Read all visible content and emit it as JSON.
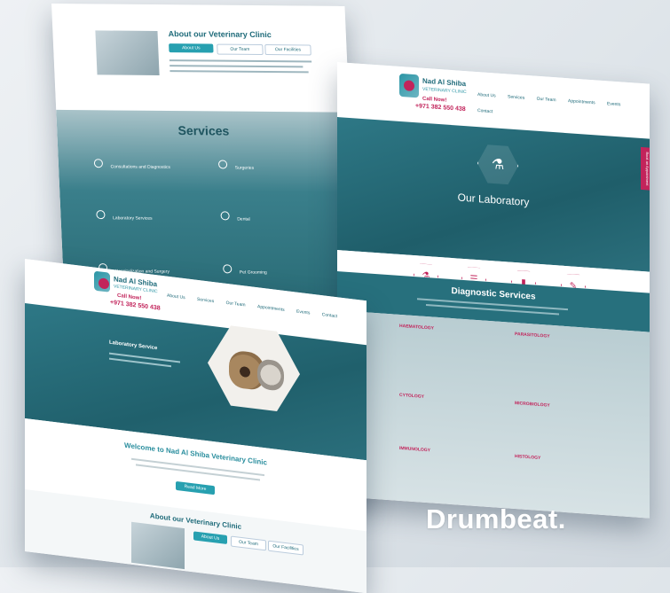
{
  "page_left": {
    "about_heading": "About our Veterinary Clinic",
    "tabs": [
      "About Us",
      "Our Team",
      "Our Facilities"
    ],
    "services_heading": "Services",
    "services": [
      {
        "title": "Consultations and Diagnostics"
      },
      {
        "title": "Laboratory Services"
      },
      {
        "title": "Hospitalization and Surgery"
      },
      {
        "title": "Surgeries"
      },
      {
        "title": "Dental"
      },
      {
        "title": "Pet Grooming"
      }
    ]
  },
  "page_front": {
    "logo_name": "Nad Al Shiba",
    "logo_sub": "VETERINARY CLINIC",
    "call_label": "Call Now!",
    "phone": "+971 382 550 438",
    "nav": [
      "About Us",
      "Services",
      "Our Team",
      "Appointments",
      "Events",
      "Contact"
    ],
    "hero_title": "Laboratory Service",
    "welcome_title": "Welcome to Nad Al Shiba Veterinary Clinic",
    "welcome_button": "Read More",
    "about_heading": "About our Veterinary Clinic",
    "tabs": [
      "About Us",
      "Our Team",
      "Our Facilities"
    ]
  },
  "page_right": {
    "logo_name": "Nad Al Shiba",
    "logo_sub": "VETERINARY CLINIC",
    "call_label": "Call Now!",
    "phone": "+971 382 550 438",
    "nav": [
      "About Us",
      "Services",
      "Our Team",
      "Appointments",
      "Events",
      "Contact"
    ],
    "side_tab": "Book an Appointment",
    "hero_title": "Our Laboratory",
    "feature_icons": [
      "microscope-icon",
      "clipboard-icon",
      "vial-icon",
      "document-icon"
    ],
    "diag_heading": "Diagnostic Services",
    "columns": [
      {
        "heading": "HAEMATOLOGY"
      },
      {
        "heading": "CYTOLOGY"
      },
      {
        "heading": "PARASITOLOGY"
      },
      {
        "heading": "MICROBIOLOGY"
      },
      {
        "heading": "IMMUNOLOGY"
      },
      {
        "heading": "HISTOLOGY"
      }
    ]
  },
  "watermark": "Drumbeat.",
  "colors": {
    "teal": "#27707d",
    "accent": "#c2245b",
    "light_teal": "#2a95a5"
  }
}
